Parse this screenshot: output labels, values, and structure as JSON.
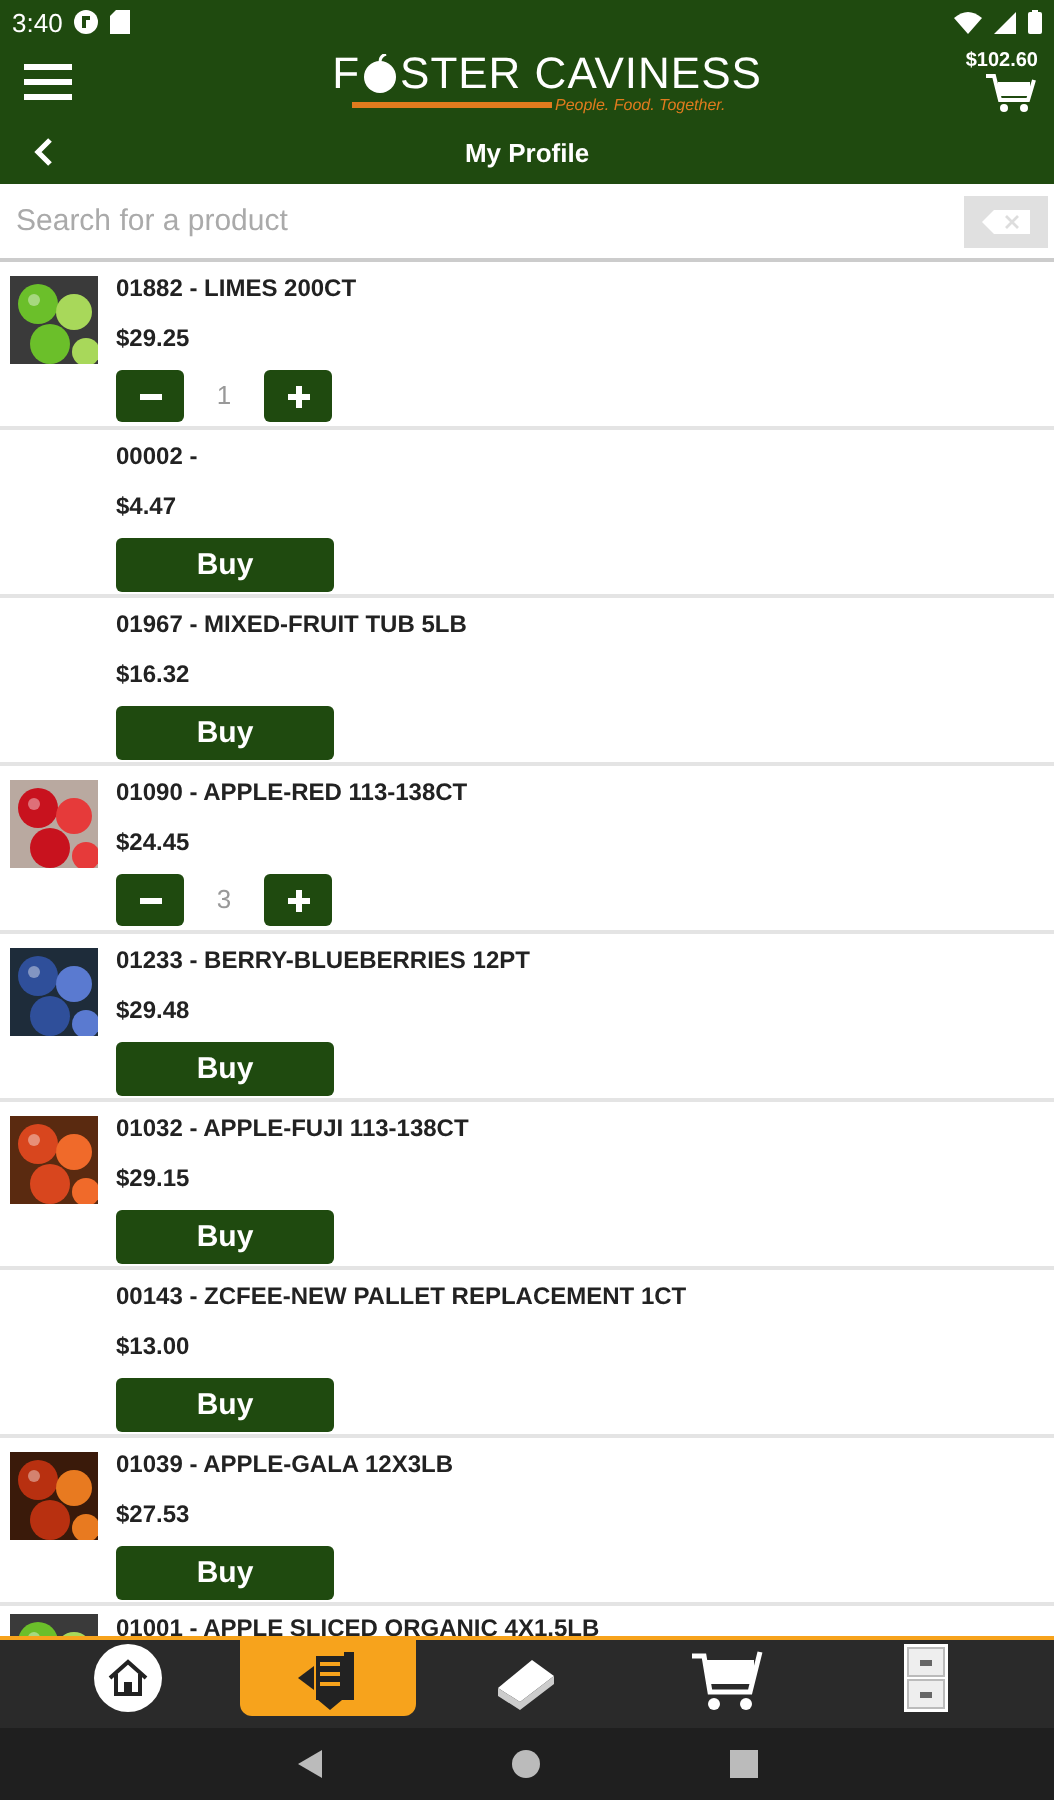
{
  "status_bar": {
    "time": "3:40"
  },
  "header": {
    "logo": {
      "before": "F",
      "after": "STER CAVINESS",
      "tagline": "People. Food. Together."
    },
    "cart_total": "$102.60",
    "title": "My Profile"
  },
  "search": {
    "placeholder": "Search for a product"
  },
  "products": [
    {
      "name": "01882 - LIMES 200CT",
      "price": "$29.25",
      "kind": "stepper",
      "quantity": "1"
    },
    {
      "name": "00002 -",
      "price": "$4.47",
      "kind": "buy",
      "button": "Buy"
    },
    {
      "name": "01967 - MIXED-FRUIT TUB 5LB",
      "price": "$16.32",
      "kind": "buy",
      "button": "Buy"
    },
    {
      "name": "01090 - APPLE-RED 113-138CT",
      "price": "$24.45",
      "kind": "stepper",
      "quantity": "3"
    },
    {
      "name": "01233 - BERRY-BLUEBERRIES 12PT",
      "price": "$29.48",
      "kind": "buy",
      "button": "Buy"
    },
    {
      "name": "01032 - APPLE-FUJI 113-138CT",
      "price": "$29.15",
      "kind": "buy",
      "button": "Buy"
    },
    {
      "name": "00143 - ZCFEE-NEW PALLET REPLACEMENT 1CT",
      "price": "$13.00",
      "kind": "buy",
      "button": "Buy"
    },
    {
      "name": "01039 - APPLE-GALA 12X3LB",
      "price": "$27.53",
      "kind": "buy",
      "button": "Buy"
    },
    {
      "name": "01001 - APPLE SLICED ORGANIC 4X1.5LB",
      "kind": "partial"
    }
  ],
  "tabs": [
    {
      "kind": "home",
      "selected": false
    },
    {
      "kind": "list",
      "selected": true
    },
    {
      "kind": "book",
      "selected": false
    },
    {
      "kind": "cart",
      "selected": false
    },
    {
      "kind": "cabinet",
      "selected": false
    }
  ]
}
